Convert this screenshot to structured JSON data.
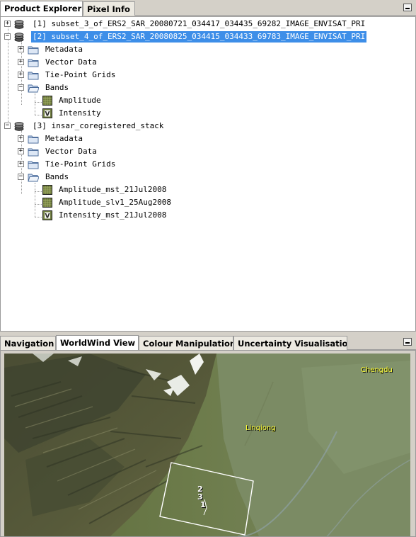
{
  "top_tabs": [
    {
      "label": "Product Explorer",
      "active": true,
      "closable": true
    },
    {
      "label": "Pixel Info",
      "active": false,
      "closable": false
    }
  ],
  "close_glyph": "⊗",
  "tree": {
    "products": [
      {
        "label": "[1] subset_3_of_ERS2_SAR_20080721_034417_034435_69282_IMAGE_ENVISAT_PRI",
        "expanded": false,
        "selected": false
      },
      {
        "label": "[2] subset_4_of_ERS2_SAR_20080825_034415_034433_69783_IMAGE_ENVISAT_PRI",
        "expanded": true,
        "selected": true,
        "nodes": [
          {
            "label": "Metadata"
          },
          {
            "label": "Vector Data"
          },
          {
            "label": "Tie-Point Grids"
          },
          {
            "label": "Bands",
            "bands": [
              {
                "label": "Amplitude",
                "icon": "band-raster-icon"
              },
              {
                "label": "Intensity",
                "icon": "band-virtual-icon",
                "icon_letter": "V"
              }
            ]
          }
        ]
      },
      {
        "label": "[3] insar_coregistered_stack",
        "expanded": true,
        "selected": false,
        "nodes": [
          {
            "label": "Metadata"
          },
          {
            "label": "Vector Data"
          },
          {
            "label": "Tie-Point Grids"
          },
          {
            "label": "Bands",
            "bands": [
              {
                "label": "Amplitude_mst_21Jul2008",
                "icon": "band-raster-icon"
              },
              {
                "label": "Amplitude_slv1_25Aug2008",
                "icon": "band-raster-icon"
              },
              {
                "label": "Intensity_mst_21Jul2008",
                "icon": "band-virtual-icon",
                "icon_letter": "V"
              }
            ]
          }
        ]
      }
    ]
  },
  "bottom_tabs": [
    {
      "label": "Navigation",
      "active": false,
      "closable": false
    },
    {
      "label": "WorldWind View",
      "active": true,
      "closable": true
    },
    {
      "label": "Colour Manipulation",
      "active": false,
      "closable": false
    },
    {
      "label": "Uncertainty Visualisation",
      "active": false,
      "closable": false
    }
  ],
  "map": {
    "places": [
      "Chengdu",
      "Linqiong"
    ],
    "footprint_numbers": [
      "2",
      "3",
      "1"
    ],
    "label_color": "#ffff33"
  },
  "colors": {
    "selection": "#3d8ee8",
    "panel_bg": "#d4d0c8"
  }
}
